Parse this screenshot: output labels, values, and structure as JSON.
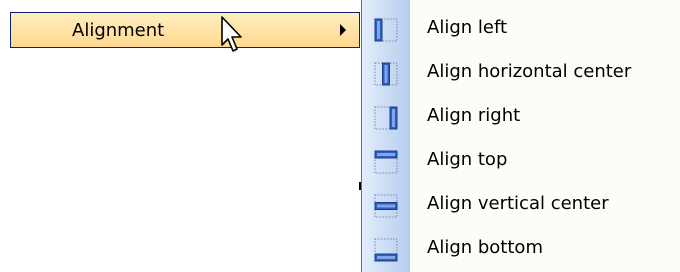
{
  "parent_menu": {
    "label": "Alignment",
    "icon": "submenu-arrow-icon"
  },
  "submenu": {
    "items": [
      {
        "label": "Align left",
        "icon": "align-left-icon"
      },
      {
        "label": "Align horizontal center",
        "icon": "align-horizontal-center-icon"
      },
      {
        "label": "Align right",
        "icon": "align-right-icon"
      },
      {
        "label": "Align top",
        "icon": "align-top-icon"
      },
      {
        "label": "Align vertical center",
        "icon": "align-vertical-center-icon"
      },
      {
        "label": "Align bottom",
        "icon": "align-bottom-icon"
      }
    ]
  },
  "colors": {
    "highlight_border": "#0a246a",
    "highlight_fill": "#ffd88e",
    "icon_blue": "#2d5fc0",
    "gutter": "#c6daf3"
  }
}
